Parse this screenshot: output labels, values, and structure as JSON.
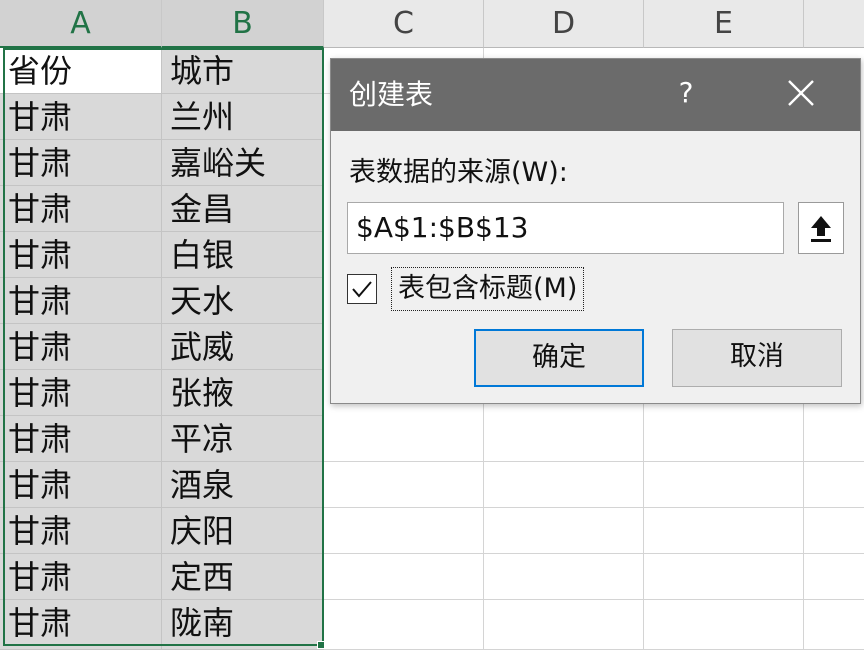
{
  "spreadsheet": {
    "columns": [
      "A",
      "B",
      "C",
      "D",
      "E"
    ],
    "rows": [
      [
        "省份",
        "城市"
      ],
      [
        "甘肃",
        "兰州"
      ],
      [
        "甘肃",
        "嘉峪关"
      ],
      [
        "甘肃",
        "金昌"
      ],
      [
        "甘肃",
        "白银"
      ],
      [
        "甘肃",
        "天水"
      ],
      [
        "甘肃",
        "武威"
      ],
      [
        "甘肃",
        "张掖"
      ],
      [
        "甘肃",
        "平凉"
      ],
      [
        "甘肃",
        "酒泉"
      ],
      [
        "甘肃",
        "庆阳"
      ],
      [
        "甘肃",
        "定西"
      ],
      [
        "甘肃",
        "陇南"
      ]
    ],
    "selection_color": "#217346"
  },
  "dialog": {
    "title": "创建表",
    "help_label": "?",
    "close_icon": "close-icon",
    "source_label": "表数据的来源(W):",
    "range_value": "$A$1:$B$13",
    "collapse_icon": "upload-arrow-icon",
    "checkbox_checked": true,
    "checkbox_label": "表包含标题(M)",
    "ok_label": "确定",
    "cancel_label": "取消",
    "accent_color": "#0078d7"
  }
}
